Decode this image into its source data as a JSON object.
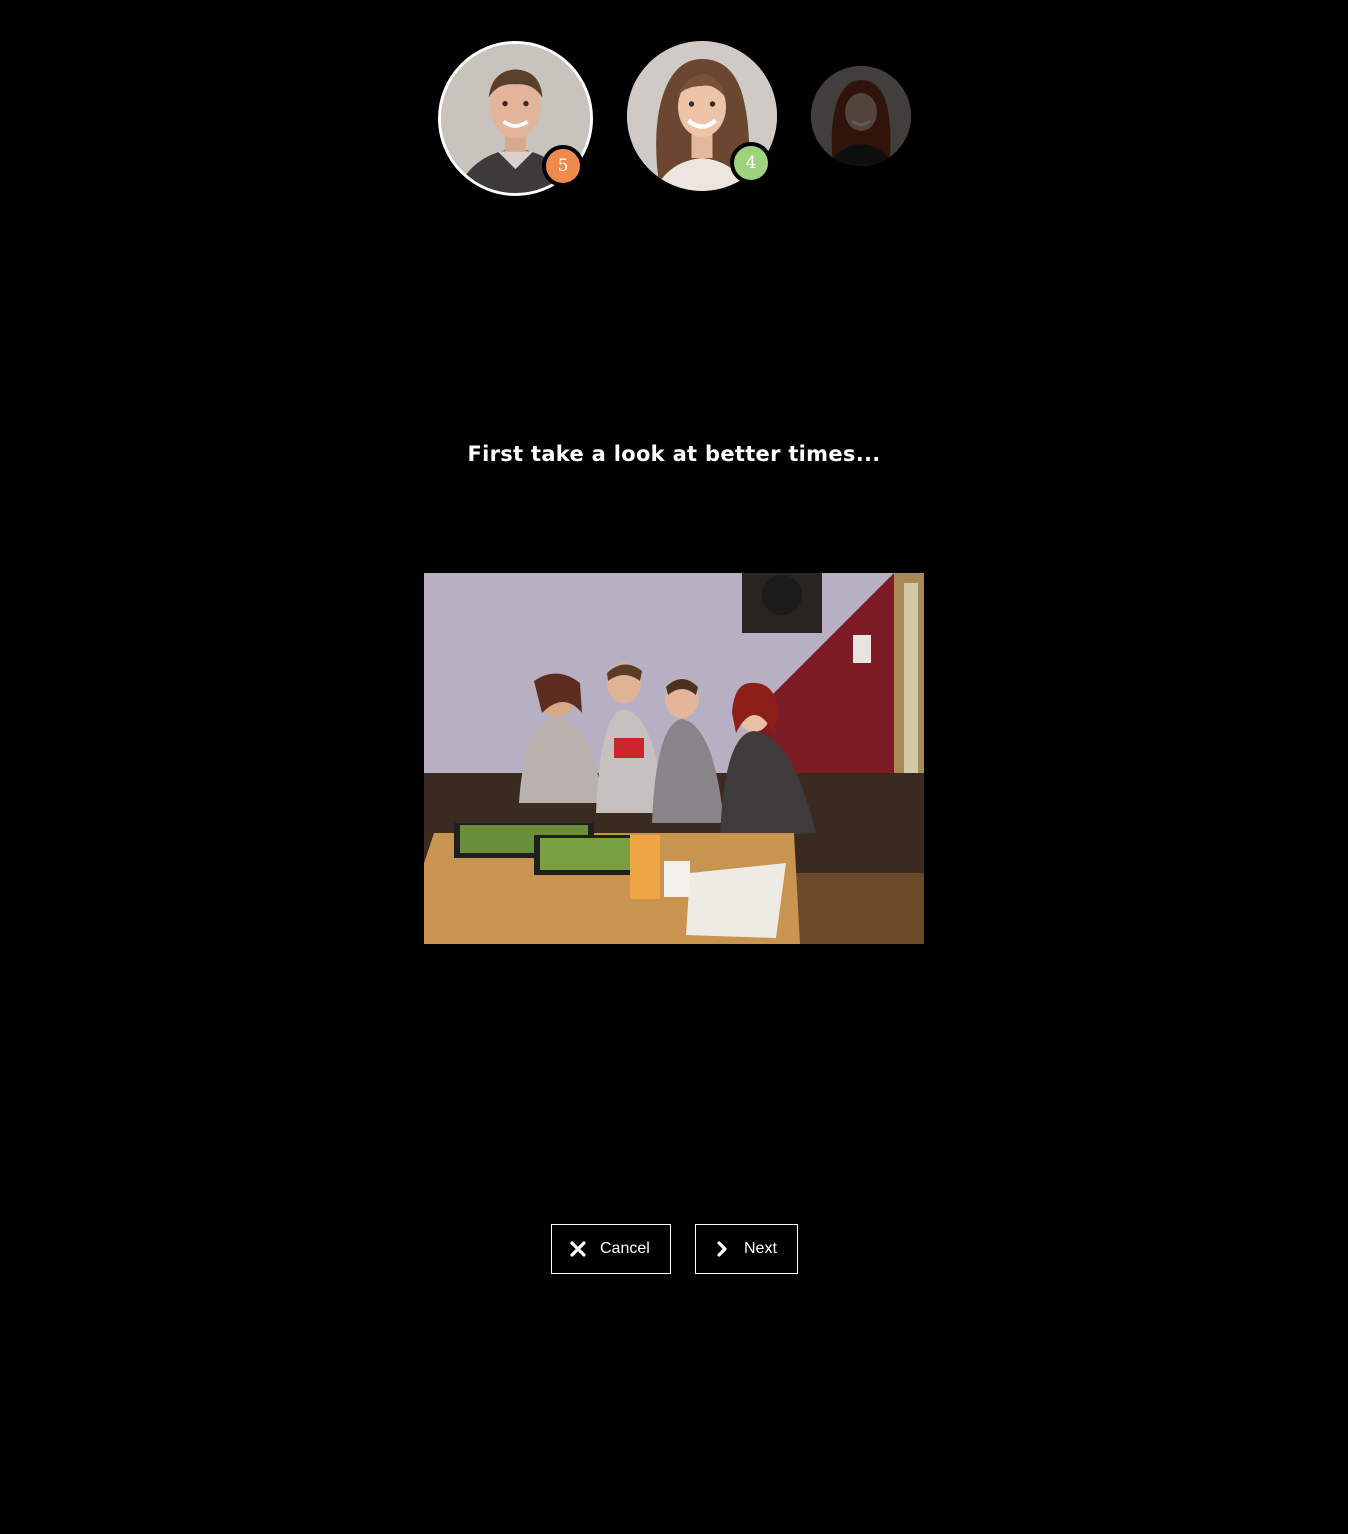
{
  "participants": [
    {
      "name_icon": "avatar-young-man",
      "badge": "5",
      "badge_color": "#f0894c",
      "selected": true
    },
    {
      "name_icon": "avatar-young-woman",
      "badge": "4",
      "badge_color": "#9fd27c",
      "selected": false
    },
    {
      "name_icon": "avatar-woman-red-hair",
      "badge": "",
      "badge_color": "",
      "selected": false
    }
  ],
  "message": "First take a look at better times...",
  "photo": {
    "subject_icon": "group-photo-pizza"
  },
  "buttons": {
    "cancel_label": "Cancel",
    "cancel_icon": "close-icon",
    "next_label": "Next",
    "next_icon": "chevron-right-icon"
  },
  "colors": {
    "background": "#000000",
    "text": "#ffffff",
    "badge_orange": "#f0894c",
    "badge_green": "#9fd27c"
  }
}
